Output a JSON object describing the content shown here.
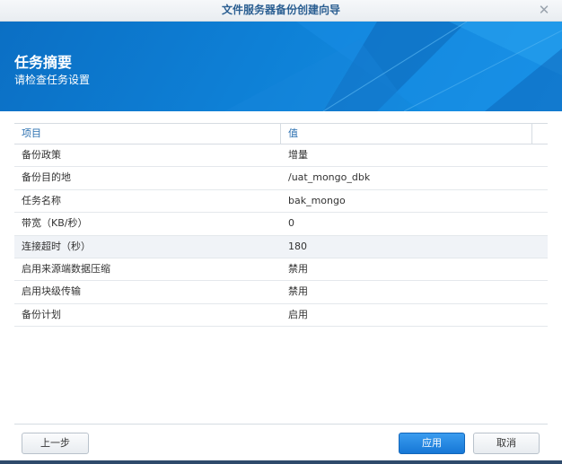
{
  "window": {
    "title": "文件服务器备份创建向导",
    "close_glyph": "✕"
  },
  "banner": {
    "heading": "任务摘要",
    "subheading": "请检查任务设置"
  },
  "table": {
    "columns": [
      "项目",
      "值"
    ],
    "rows": [
      {
        "key": "备份政策",
        "value": "增量"
      },
      {
        "key": "备份目的地",
        "value": "/uat_mongo_dbk"
      },
      {
        "key": "任务名称",
        "value": "bak_mongo"
      },
      {
        "key": "带宽（KB/秒）",
        "value": "0"
      },
      {
        "key": "连接超时（秒）",
        "value": "180"
      },
      {
        "key": "启用来源端数据压缩",
        "value": "禁用"
      },
      {
        "key": "启用块级传输",
        "value": "禁用"
      },
      {
        "key": "备份计划",
        "value": "启用"
      }
    ]
  },
  "buttons": {
    "prev": "上一步",
    "apply": "应用",
    "cancel": "取消"
  },
  "colors": {
    "accent": "#1677d6",
    "banner": "#0e80d6",
    "title_text": "#2b5f92"
  }
}
